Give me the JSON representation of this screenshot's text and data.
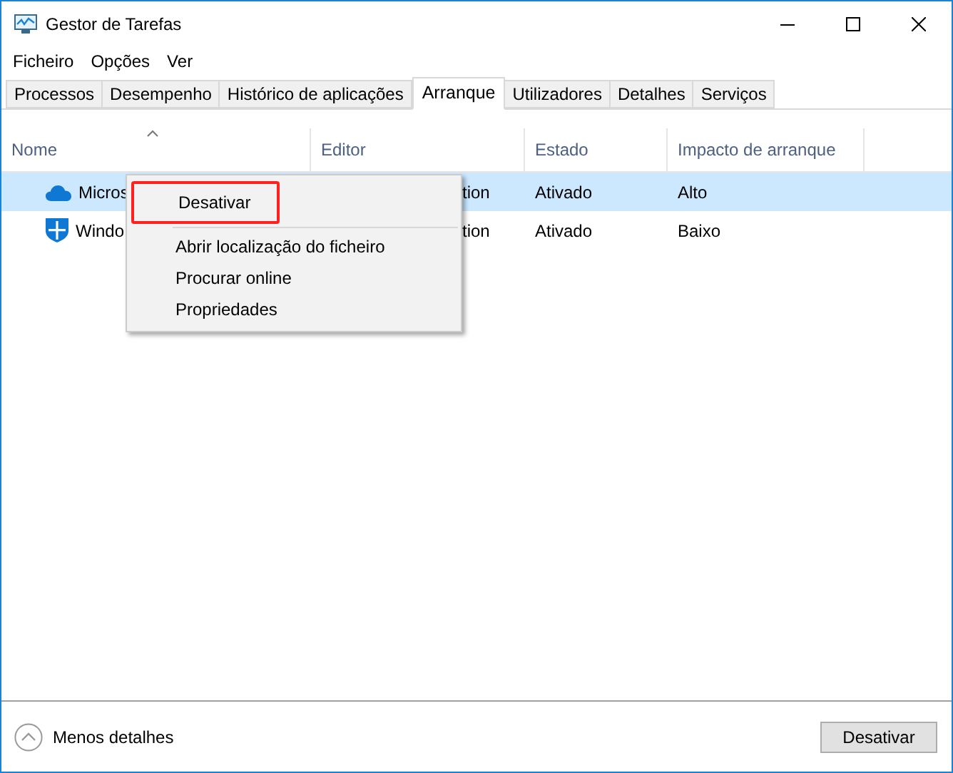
{
  "window": {
    "title": "Gestor de Tarefas"
  },
  "menu_bar": [
    "Ficheiro",
    "Opções",
    "Ver"
  ],
  "tabs": [
    {
      "label": "Processos",
      "selected": false
    },
    {
      "label": "Desempenho",
      "selected": false
    },
    {
      "label": "Histórico de aplicações",
      "selected": false
    },
    {
      "label": "Arranque",
      "selected": true
    },
    {
      "label": "Utilizadores",
      "selected": false
    },
    {
      "label": "Detalhes",
      "selected": false
    },
    {
      "label": "Serviços",
      "selected": false
    }
  ],
  "table": {
    "columns": [
      "Nome",
      "Editor",
      "Estado",
      "Impacto de arranque"
    ],
    "rows": [
      {
        "kind": "cloud",
        "name": "Micros",
        "editor": "tion",
        "status": "Ativado",
        "impact": "Alto",
        "selected": true
      },
      {
        "kind": "shield",
        "name": "Windo",
        "editor": "tion",
        "status": "Ativado",
        "impact": "Baixo",
        "selected": false
      }
    ]
  },
  "context_menu": {
    "items": [
      {
        "label": "Desativar",
        "highlighted": true
      },
      {
        "label": "Abrir localização do ficheiro",
        "highlighted": false
      },
      {
        "label": "Procurar online",
        "highlighted": false
      },
      {
        "label": "Propriedades",
        "highlighted": false
      }
    ]
  },
  "footer": {
    "details_toggle": "Menos detalhes",
    "button": "Desativar"
  }
}
